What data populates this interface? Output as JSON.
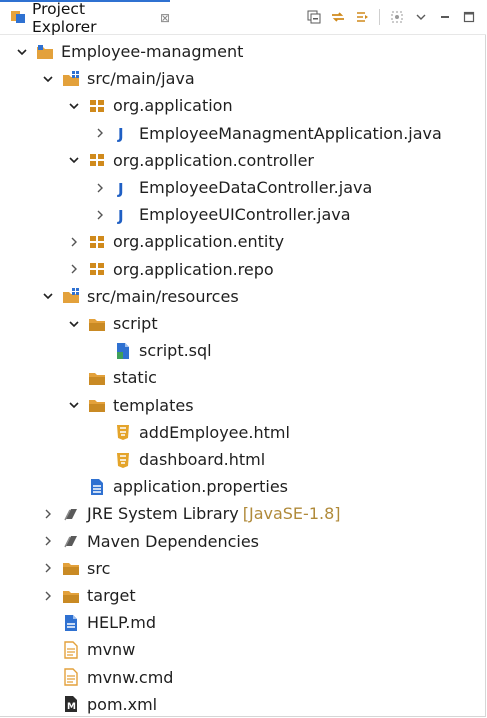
{
  "view": {
    "title": "Project Explorer",
    "close_glyph": "⊠"
  },
  "toolbar": {
    "icons": [
      "collapse-all-icon",
      "link-with-editor-icon",
      "filter-icon",
      "focus-icon",
      "view-menu-icon",
      "minimize-icon",
      "maximize-icon"
    ]
  },
  "tree": [
    {
      "label": "Employee-managment",
      "depth": 0,
      "expanded": true,
      "icon": "project-folder-icon"
    },
    {
      "label": "src/main/java",
      "depth": 1,
      "expanded": true,
      "icon": "source-folder-icon"
    },
    {
      "label": "org.application",
      "depth": 2,
      "expanded": true,
      "icon": "package-icon"
    },
    {
      "label": "EmployeeManagmentApplication.java",
      "depth": 3,
      "expanded": false,
      "icon": "java-file-icon"
    },
    {
      "label": "org.application.controller",
      "depth": 2,
      "expanded": true,
      "icon": "package-icon"
    },
    {
      "label": "EmployeeDataController.java",
      "depth": 3,
      "expanded": false,
      "icon": "java-file-icon"
    },
    {
      "label": "EmployeeUIController.java",
      "depth": 3,
      "expanded": false,
      "icon": "java-file-icon"
    },
    {
      "label": "org.application.entity",
      "depth": 2,
      "expanded": false,
      "icon": "package-icon"
    },
    {
      "label": "org.application.repo",
      "depth": 2,
      "expanded": false,
      "icon": "package-icon"
    },
    {
      "label": "src/main/resources",
      "depth": 1,
      "expanded": true,
      "icon": "source-folder-icon"
    },
    {
      "label": "script",
      "depth": 2,
      "expanded": true,
      "icon": "folder-icon"
    },
    {
      "label": "script.sql",
      "depth": 3,
      "expanded": null,
      "icon": "sql-file-icon"
    },
    {
      "label": "static",
      "depth": 2,
      "expanded": null,
      "icon": "folder-icon"
    },
    {
      "label": "templates",
      "depth": 2,
      "expanded": true,
      "icon": "folder-icon"
    },
    {
      "label": "addEmployee.html",
      "depth": 3,
      "expanded": null,
      "icon": "html-file-icon"
    },
    {
      "label": "dashboard.html",
      "depth": 3,
      "expanded": null,
      "icon": "html-file-icon"
    },
    {
      "label": "application.properties",
      "depth": 2,
      "expanded": null,
      "icon": "properties-file-icon"
    },
    {
      "label": "JRE System Library",
      "depth": 1,
      "expanded": false,
      "icon": "library-icon",
      "decoration": "[JavaSE-1.8]"
    },
    {
      "label": "Maven Dependencies",
      "depth": 1,
      "expanded": false,
      "icon": "library-icon"
    },
    {
      "label": "src",
      "depth": 1,
      "expanded": false,
      "icon": "folder-icon"
    },
    {
      "label": "target",
      "depth": 1,
      "expanded": false,
      "icon": "folder-icon"
    },
    {
      "label": "HELP.md",
      "depth": 1,
      "expanded": null,
      "icon": "markdown-file-icon"
    },
    {
      "label": "mvnw",
      "depth": 1,
      "expanded": null,
      "icon": "text-file-icon"
    },
    {
      "label": "mvnw.cmd",
      "depth": 1,
      "expanded": null,
      "icon": "text-file-icon"
    },
    {
      "label": "pom.xml",
      "depth": 1,
      "expanded": null,
      "icon": "xml-file-icon"
    }
  ]
}
